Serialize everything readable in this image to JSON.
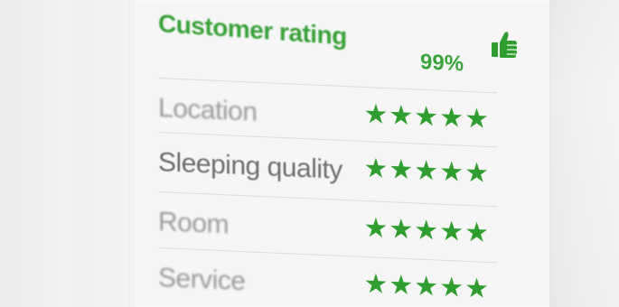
{
  "header": {
    "title": "Customer rating",
    "percent": "99%",
    "icon": "thumbs-up-icon"
  },
  "ratings": [
    {
      "label": "Location",
      "stars": 5,
      "glyph": "★★★★★"
    },
    {
      "label": "Sleeping quality",
      "stars": 5,
      "glyph": "★★★★★"
    },
    {
      "label": "Room",
      "stars": 5,
      "glyph": "★★★★★"
    },
    {
      "label": "Service",
      "stars": 5,
      "glyph": "★★★★★"
    }
  ],
  "colors": {
    "accent_green": "#3aa33a",
    "star_green": "#2f9e2f",
    "label_gray": "#9b9b9b"
  }
}
